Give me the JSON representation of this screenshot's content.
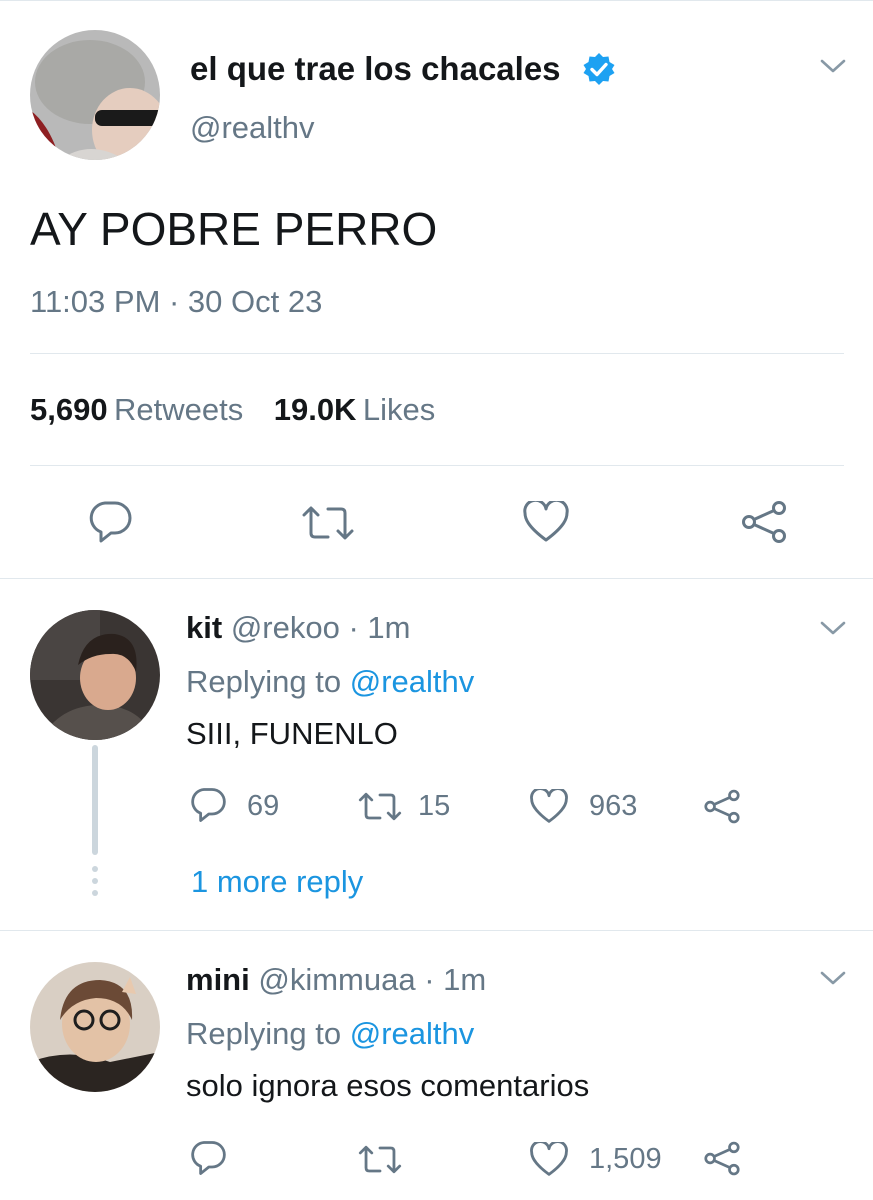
{
  "main_tweet": {
    "display_name": "el que trae los chacales",
    "verified": true,
    "handle": "@realthv",
    "text": "AY POBRE PERRO",
    "timestamp": "11:03 PM · 30 Oct 23",
    "retweets_count": "5,690",
    "retweets_label": "Retweets",
    "likes_count": "19.0K",
    "likes_label": "Likes"
  },
  "replies": [
    {
      "display_name": "kit",
      "handle": "@rekoo",
      "time": "· 1m",
      "replying_prefix": "Replying to",
      "replying_to": "@realthv",
      "text": "SIII, FUNENLO",
      "reply_count": "69",
      "retweet_count": "15",
      "like_count": "963",
      "more_replies": "1 more reply"
    },
    {
      "display_name": "mini",
      "handle": "@kimmuaa",
      "time": "· 1m",
      "replying_prefix": "Replying to",
      "replying_to": "@realthv",
      "text": "solo ignora esos comentarios",
      "reply_count": "",
      "retweet_count": "",
      "like_count": "1,509"
    }
  ],
  "colors": {
    "accent": "#1b95e0",
    "verified_badge": "#1da1f2",
    "secondary_text": "#657786",
    "icon_gray": "#657786",
    "divider": "#e1e8ed"
  }
}
